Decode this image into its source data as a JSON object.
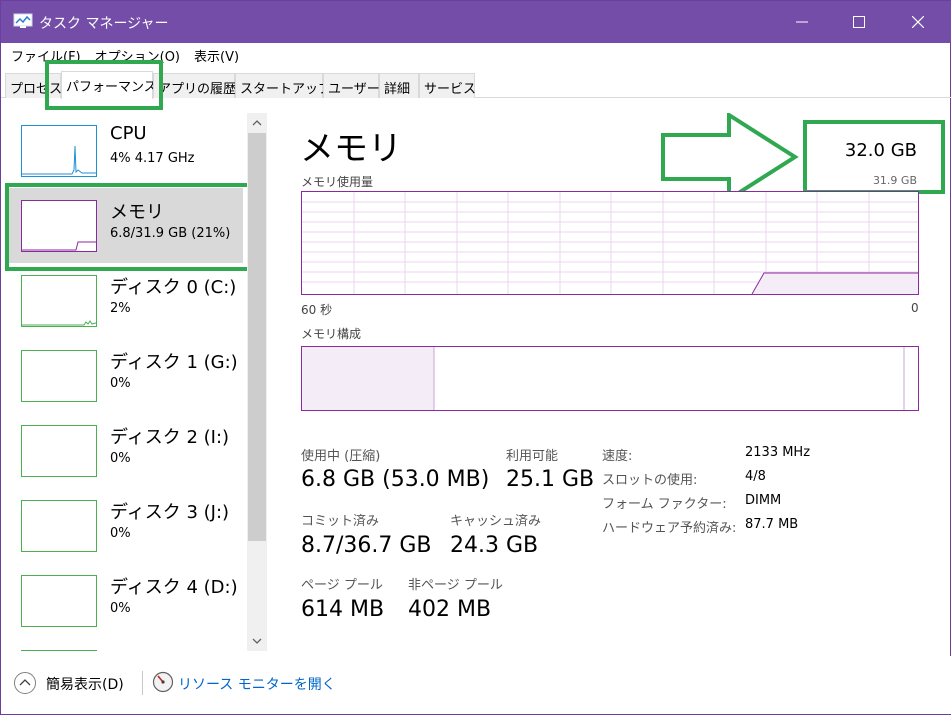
{
  "window": {
    "title": "タスク マネージャー"
  },
  "menu": [
    "ファイル(F)",
    "オプション(O)",
    "表示(V)"
  ],
  "tabs": [
    "プロセス",
    "パフォーマンス",
    "アプリの履歴",
    "スタートアップ",
    "ユーザー",
    "詳細",
    "サービス"
  ],
  "active_tab": "パフォーマンス",
  "sidebar": {
    "items": [
      {
        "name": "CPU",
        "sub": "4%  4.17 GHz",
        "usage": 0.04
      },
      {
        "name": "メモリ",
        "sub": "6.8/31.9 GB (21%)",
        "usage": 0.21
      },
      {
        "name": "ディスク 0 (C:)",
        "sub": "2%",
        "usage": 0.02
      },
      {
        "name": "ディスク 1 (G:)",
        "sub": "0%",
        "usage": 0
      },
      {
        "name": "ディスク 2 (I:)",
        "sub": "0%",
        "usage": 0
      },
      {
        "name": "ディスク 3 (J:)",
        "sub": "0%",
        "usage": 0
      },
      {
        "name": "ディスク 4 (D:)",
        "sub": "0%",
        "usage": 0
      }
    ],
    "selected": "メモリ"
  },
  "main": {
    "title": "メモリ",
    "total": "32.0 GB",
    "total_sub": "31.9 GB",
    "usage_chart_label": "メモリ使用量",
    "axis_left": "60 秒",
    "axis_right": "0",
    "composition_label": "メモリ構成",
    "stats": {
      "in_use_label": "使用中 (圧縮)",
      "in_use_value": "6.8 GB (53.0 MB)",
      "available_label": "利用可能",
      "available_value": "25.1 GB",
      "committed_label": "コミット済み",
      "committed_value": "8.7/36.7 GB",
      "cached_label": "キャッシュ済み",
      "cached_value": "24.3 GB",
      "paged_label": "ページ プール",
      "paged_value": "614 MB",
      "nonpaged_label": "非ページ プール",
      "nonpaged_value": "402 MB"
    },
    "details": [
      {
        "label": "速度:",
        "value": "2133 MHz"
      },
      {
        "label": "スロットの使用:",
        "value": "4/8"
      },
      {
        "label": "フォーム ファクター:",
        "value": "DIMM"
      },
      {
        "label": "ハードウェア予約済み:",
        "value": "87.7 MB"
      }
    ]
  },
  "footer": {
    "fewer_details": "簡易表示(D)",
    "resource_monitor": "リソース モニターを開く"
  },
  "colors": {
    "titlebar": "#744da9",
    "memory_line": "#8b2a9e",
    "disk_line": "#4caf50",
    "cpu_line": "#1e90d6",
    "highlight": "#2fa84f"
  }
}
